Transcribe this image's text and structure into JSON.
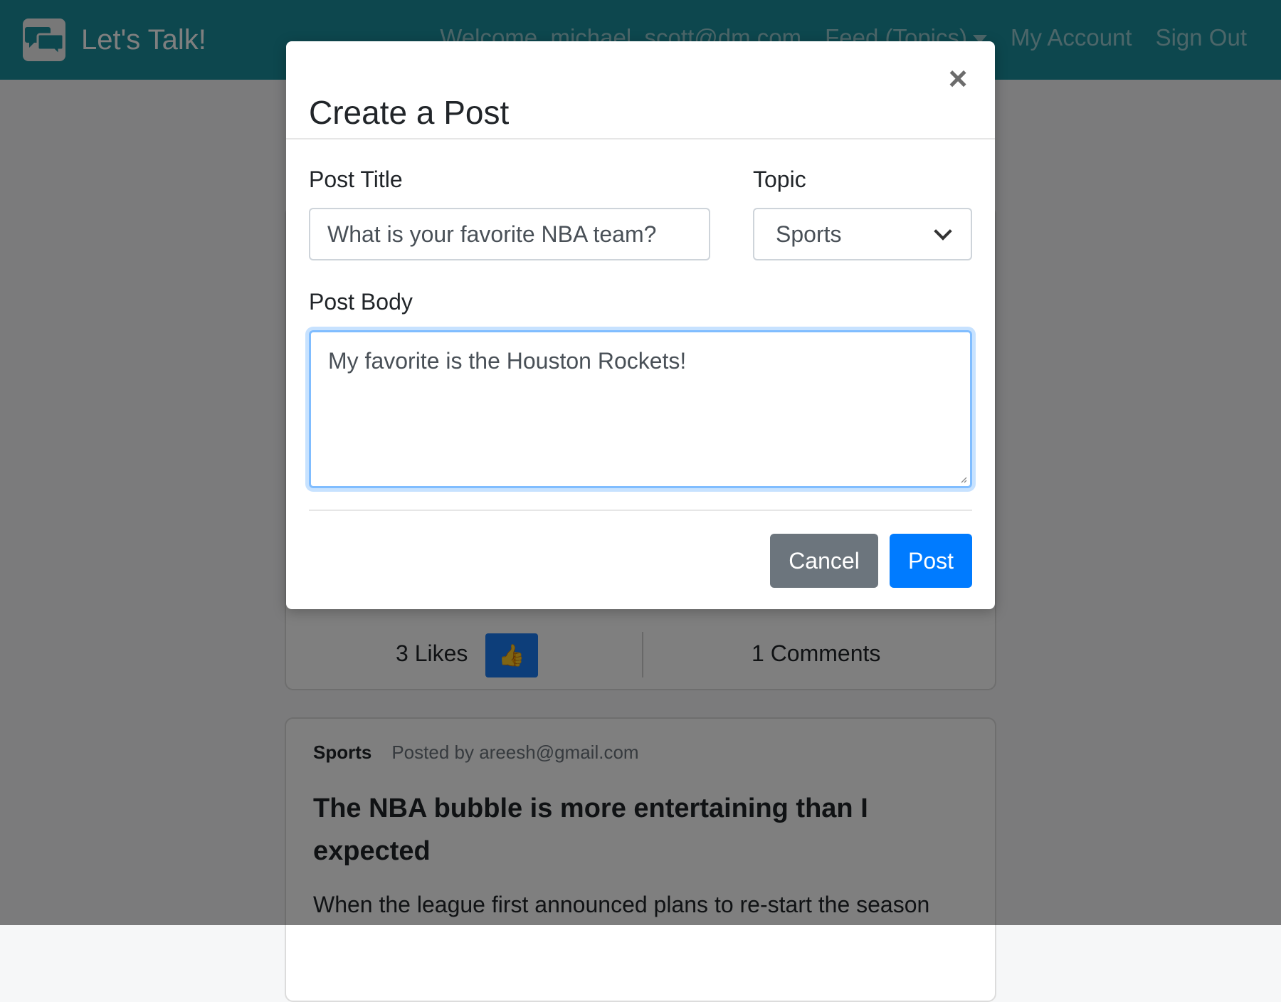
{
  "navbar": {
    "brand": "Let's Talk!",
    "welcome": "Welcome, michael_scott@dm.com",
    "feed_label": "Feed (Topics)",
    "account_label": "My Account",
    "signout_label": "Sign Out",
    "color": "#1b8e9c"
  },
  "feed": {
    "posts": [
      {
        "likes_label": "3 Likes",
        "like_icon": "👍",
        "comments_label": "1 Comments"
      },
      {
        "topic": "Sports",
        "author": "Posted by areesh@gmail.com",
        "title": "The NBA bubble is more entertaining than I expected",
        "body": "When the league first announced plans to re-start the season"
      }
    ]
  },
  "modal": {
    "title": "Create a Post",
    "close_icon": "×",
    "post_title_label": "Post Title",
    "post_title_value": "What is your favorite NBA team?",
    "topic_label": "Topic",
    "topic_value": "Sports",
    "post_body_label": "Post Body",
    "post_body_value": "My favorite is the Houston Rockets!",
    "cancel_label": "Cancel",
    "post_label": "Post"
  },
  "colors": {
    "primary": "#007bff",
    "secondary": "#6c757d",
    "focus_border": "#80bdff"
  }
}
